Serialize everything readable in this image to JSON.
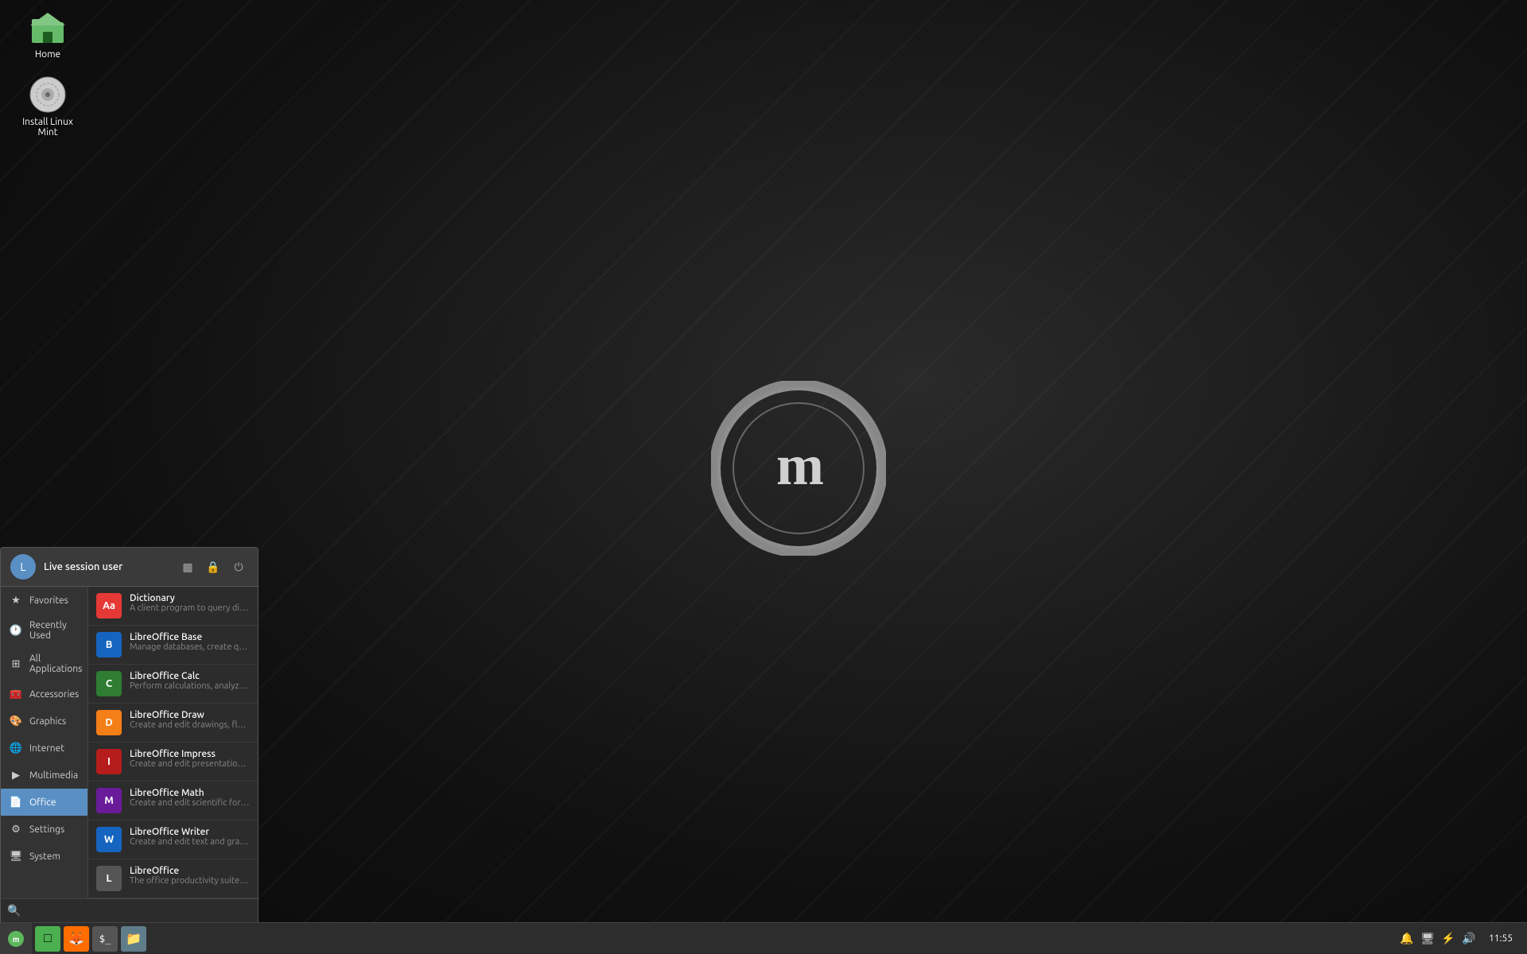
{
  "desktop": {
    "icons": [
      {
        "id": "home",
        "label": "Home",
        "icon": "🏠",
        "color": "#5cb85c"
      },
      {
        "id": "install",
        "label": "Install Linux\nMint",
        "icon": "💿",
        "color": "#aaa"
      }
    ]
  },
  "start_menu": {
    "user": {
      "name": "Live session user",
      "avatar_letter": "L"
    },
    "header_icons": [
      {
        "id": "software-manager",
        "symbol": "▦",
        "title": "Software Manager"
      },
      {
        "id": "lock",
        "symbol": "🔒",
        "title": "Lock Screen"
      },
      {
        "id": "logout",
        "symbol": "⏻",
        "title": "Log Out"
      }
    ],
    "sidebar_items": [
      {
        "id": "favorites",
        "label": "Favorites",
        "icon": "★",
        "active": false
      },
      {
        "id": "recently-used",
        "label": "Recently Used",
        "icon": "🕐",
        "active": false
      },
      {
        "id": "all-applications",
        "label": "All Applications",
        "icon": "⊞",
        "active": false
      },
      {
        "id": "accessories",
        "label": "Accessories",
        "icon": "🧰",
        "active": false
      },
      {
        "id": "graphics",
        "label": "Graphics",
        "icon": "🎨",
        "active": false
      },
      {
        "id": "internet",
        "label": "Internet",
        "icon": "🌐",
        "active": false
      },
      {
        "id": "multimedia",
        "label": "Multimedia",
        "icon": "▶",
        "active": false
      },
      {
        "id": "office",
        "label": "Office",
        "icon": "📄",
        "active": true
      },
      {
        "id": "settings",
        "label": "Settings",
        "icon": "⚙",
        "active": false
      },
      {
        "id": "system",
        "label": "System",
        "icon": "🖥",
        "active": false
      }
    ],
    "apps": [
      {
        "id": "dictionary",
        "name": "Dictionary",
        "desc": "A client program to query different dicti...",
        "icon_color": "#e53935",
        "icon_letter": "Aa"
      },
      {
        "id": "libreoffice-base",
        "name": "LibreOffice Base",
        "desc": "Manage databases, create queries and r...",
        "icon_color": "#1565c0",
        "icon_letter": "B"
      },
      {
        "id": "libreoffice-calc",
        "name": "LibreOffice Calc",
        "desc": "Perform calculations, analyze informatio...",
        "icon_color": "#2e7d32",
        "icon_letter": "C"
      },
      {
        "id": "libreoffice-draw",
        "name": "LibreOffice Draw",
        "desc": "Create and edit drawings, flow charts an...",
        "icon_color": "#f57f17",
        "icon_letter": "D"
      },
      {
        "id": "libreoffice-impress",
        "name": "LibreOffice Impress",
        "desc": "Create and edit presentations for slides...",
        "icon_color": "#b71c1c",
        "icon_letter": "I"
      },
      {
        "id": "libreoffice-math",
        "name": "LibreOffice Math",
        "desc": "Create and edit scientific formulas and e...",
        "icon_color": "#6a1b9a",
        "icon_letter": "M"
      },
      {
        "id": "libreoffice-writer",
        "name": "LibreOffice Writer",
        "desc": "Create and edit text and graphics in lett...",
        "icon_color": "#1565c0",
        "icon_letter": "W"
      },
      {
        "id": "libreoffice",
        "name": "LibreOffice",
        "desc": "The office productivity suite compatible...",
        "icon_color": "#555",
        "icon_letter": "L"
      }
    ],
    "search": {
      "placeholder": "",
      "icon": "🔍"
    }
  },
  "taskbar": {
    "start_icon": "🌿",
    "apps": [
      {
        "id": "show-desktop",
        "color": "#4caf50",
        "icon": "□",
        "title": "Show Desktop"
      },
      {
        "id": "firefox",
        "color": "#ff6d00",
        "icon": "🦊",
        "title": "Firefox"
      },
      {
        "id": "terminal",
        "color": "#555",
        "icon": "$",
        "title": "Terminal"
      },
      {
        "id": "files",
        "color": "#607d8b",
        "icon": "📁",
        "title": "Files"
      }
    ],
    "tray": [
      {
        "id": "notification",
        "icon": "🔔"
      },
      {
        "id": "display",
        "icon": "🖥"
      },
      {
        "id": "power",
        "icon": "⚡"
      },
      {
        "id": "volume",
        "icon": "🔊"
      }
    ],
    "clock": "11:55"
  }
}
